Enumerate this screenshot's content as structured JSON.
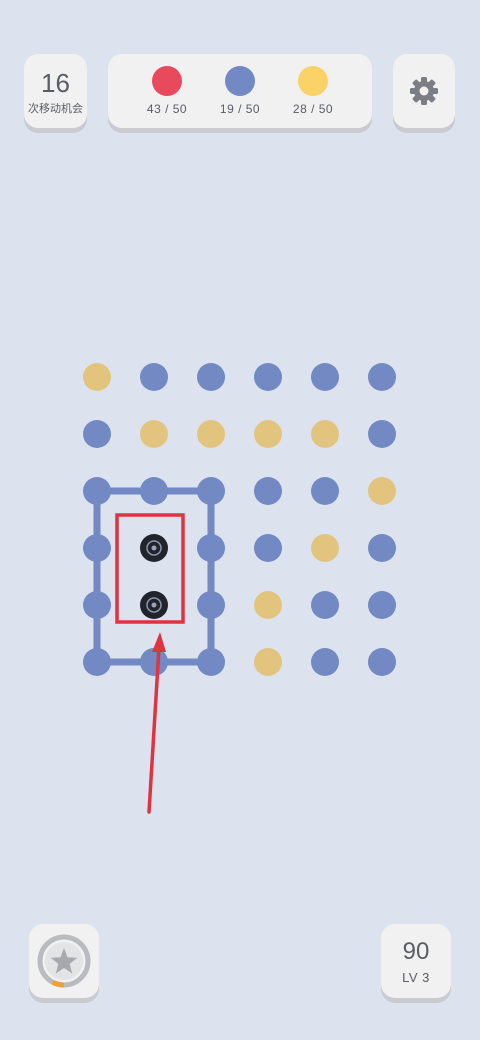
{
  "moves": {
    "count": "16",
    "label": "次移动机会"
  },
  "goals": [
    {
      "color": "#e8495d",
      "text": "43 / 50"
    },
    {
      "color": "#7289c3",
      "text": "19 / 50"
    },
    {
      "color": "#fbd267",
      "text": "28 / 50"
    }
  ],
  "settings": {
    "icon": "gear-icon"
  },
  "board": {
    "colors": {
      "blue": "#7289c3",
      "yellow": "#e2c47f",
      "hole": "#21242c"
    },
    "rows": [
      [
        "yellow",
        "blue",
        "blue",
        "blue",
        "blue",
        "blue"
      ],
      [
        "blue",
        "yellow",
        "yellow",
        "yellow",
        "yellow",
        "blue"
      ],
      [
        "blue",
        "blue",
        "blue",
        "blue",
        "blue",
        "yellow"
      ],
      [
        "blue",
        "hole",
        "blue",
        "blue",
        "yellow",
        "blue"
      ],
      [
        "blue",
        "hole",
        "blue",
        "yellow",
        "blue",
        "blue"
      ],
      [
        "blue",
        "blue",
        "blue",
        "yellow",
        "blue",
        "blue"
      ]
    ],
    "loop": [
      [
        2,
        0
      ],
      [
        2,
        1
      ],
      [
        2,
        2
      ],
      [
        3,
        2
      ],
      [
        4,
        2
      ],
      [
        5,
        2
      ],
      [
        5,
        1
      ],
      [
        5,
        0
      ],
      [
        4,
        0
      ],
      [
        3,
        0
      ],
      [
        2,
        0
      ]
    ],
    "highlight_color": "#e0333f"
  },
  "bottom": {
    "star_icon": "star-icon",
    "score": "90",
    "level": "LV 3",
    "progress_color": "#f0a030"
  }
}
